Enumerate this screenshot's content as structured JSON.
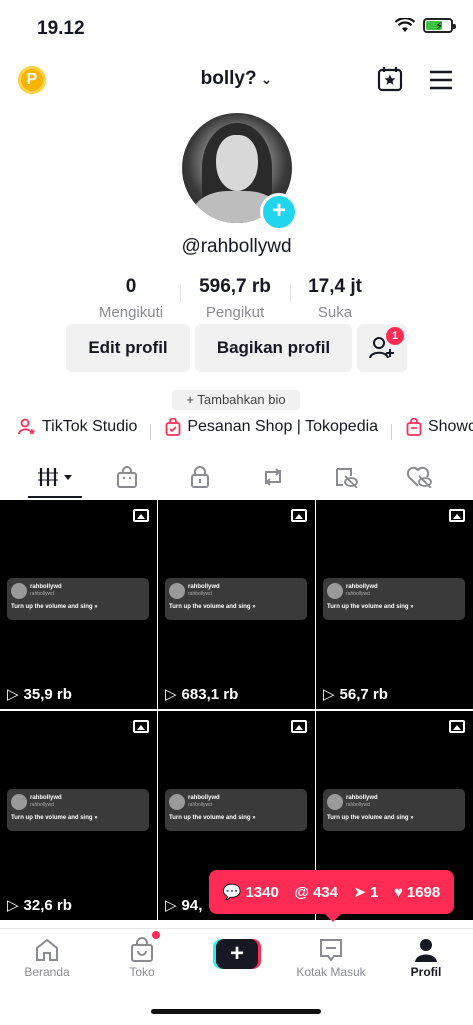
{
  "status": {
    "time": "19.12"
  },
  "header": {
    "coin_letter": "P",
    "username": "bolly?"
  },
  "profile": {
    "handle": "@rahbollywd",
    "stats": [
      {
        "num": "0",
        "label": "Mengikuti"
      },
      {
        "num": "596,7 rb",
        "label": "Pengikut"
      },
      {
        "num": "17,4 jt",
        "label": "Suka"
      }
    ],
    "edit_label": "Edit profil",
    "share_label": "Bagikan profil",
    "friend_badge": "1",
    "bio_label": "+ Tambahkan bio"
  },
  "links": [
    {
      "label": "TikTok Studio",
      "icon": "person-star-icon"
    },
    {
      "label": "Pesanan Shop | Tokopedia",
      "icon": "shopping-bag-icon"
    },
    {
      "label": "Showc",
      "icon": "shop-bag-icon"
    }
  ],
  "tabs": [
    "grid-icon",
    "shop-bag-icon",
    "lock-icon",
    "repost-icon",
    "eye-hidden-icon",
    "heart-hidden-icon"
  ],
  "posts": [
    {
      "views": "35,9 rb"
    },
    {
      "views": "683,1 rb"
    },
    {
      "views": "56,7 rb"
    },
    {
      "views": "32,6 rb"
    },
    {
      "views": "94,"
    },
    {
      "views": ""
    }
  ],
  "post_card": {
    "name": "rahbollywd",
    "sub": "rahbollywd",
    "text": "Turn up the volume and sing »"
  },
  "notif_popup": {
    "comments": "1340",
    "mentions": "434",
    "shares": "1",
    "likes": "1698"
  },
  "bottom_nav": [
    {
      "label": "Beranda",
      "icon": "home-icon"
    },
    {
      "label": "Toko",
      "icon": "shop-icon"
    },
    {
      "label": "",
      "icon": "create-plus-icon"
    },
    {
      "label": "Kotak Masuk",
      "icon": "inbox-icon"
    },
    {
      "label": "Profil",
      "icon": "profile-icon"
    }
  ],
  "colors": {
    "accent": "#fe2c55",
    "cyan": "#25f4ee",
    "plus_badge": "#20d5ec"
  }
}
